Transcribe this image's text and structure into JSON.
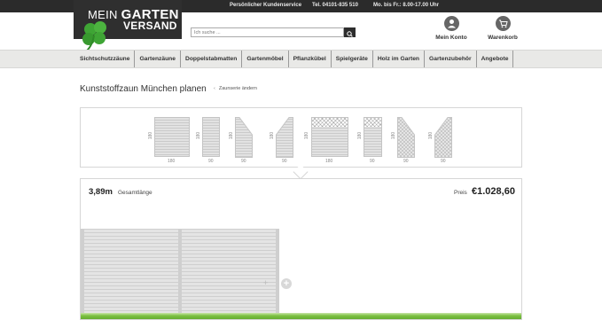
{
  "topbar": {
    "service": "Persönlicher Kundenservice",
    "phone": "Tel. 04101-835 510",
    "hours": "Mo. bis Fr.: 8.00-17.00 Uhr"
  },
  "logo": {
    "line1a": "MEIN",
    "line1b": "GARTEN",
    "line2": "VERSAND"
  },
  "search": {
    "placeholder": "Ich suche ..."
  },
  "account": {
    "label": "Mein Konto"
  },
  "cart": {
    "label": "Warenkorb"
  },
  "nav": [
    "Sichtschutzzäune",
    "Gartenzäune",
    "Doppelstabmatten",
    "Gartenmöbel",
    "Pflanzkübel",
    "Spielgeräte",
    "Holz im Garten",
    "Gartenzubehör",
    "Angebote"
  ],
  "page": {
    "title": "Kunststoffzaun München planen",
    "back_link": "Zaunserie ändern"
  },
  "elements": [
    {
      "type": "square",
      "style": "slats",
      "height": "180",
      "width": "180"
    },
    {
      "type": "rect",
      "style": "slats",
      "height": "180",
      "width": "90"
    },
    {
      "type": "slope-left",
      "style": "slats",
      "height": "180",
      "width": "90"
    },
    {
      "type": "slope-right",
      "style": "slats",
      "height": "180",
      "width": "90"
    },
    {
      "type": "square",
      "style": "lattice-top",
      "height": "180",
      "width": "180"
    },
    {
      "type": "rect",
      "style": "lattice-top",
      "height": "180",
      "width": "90"
    },
    {
      "type": "slope-left",
      "style": "lattice",
      "height": "180",
      "width": "90"
    },
    {
      "type": "slope-right",
      "style": "lattice",
      "height": "180",
      "width": "90"
    }
  ],
  "summary": {
    "length": "3,89m",
    "length_label": "Gesamtlänge",
    "price_label": "Preis",
    "price": "€1.028,60"
  },
  "colors": {
    "accent": "#2b2b2b",
    "grass": "#5aa22a",
    "clover": "#3fa535"
  }
}
